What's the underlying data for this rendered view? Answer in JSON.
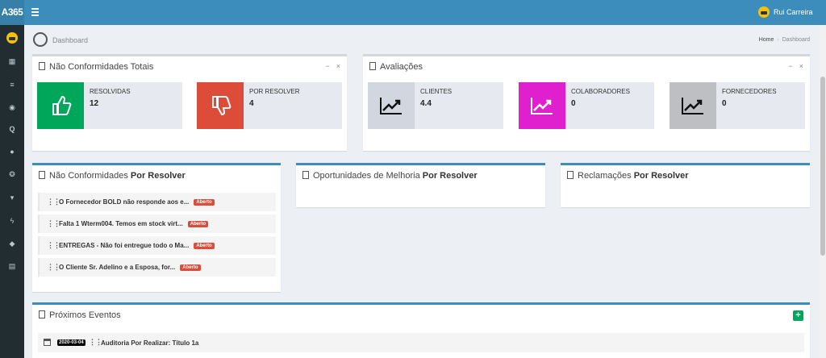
{
  "app": {
    "logo": "A365",
    "user": "Rui Carreira"
  },
  "page": {
    "title": "Dashboard"
  },
  "breadcrumb": {
    "home": "Home",
    "current": "Dashboard"
  },
  "sidebar": {
    "icons": [
      "avatar-icon",
      "calendar-icon",
      "list-icon",
      "target-icon",
      "search-icon",
      "info-icon",
      "globe-icon",
      "cart-icon",
      "flash-icon",
      "handshake-icon",
      "file-icon"
    ]
  },
  "nc_totais": {
    "title": "Não Conformidades Totais",
    "items": [
      {
        "label": "RESOLVIDAS",
        "value": "12",
        "color": "#00a65a",
        "icon": "thumbs-up-icon"
      },
      {
        "label": "POR RESOLVER",
        "value": "4",
        "color": "#dd4b39",
        "icon": "thumbs-down-icon"
      }
    ]
  },
  "avaliacoes": {
    "title": "Avaliações",
    "items": [
      {
        "label": "CLIENTES",
        "value": "4.4",
        "color": "#d2d6de",
        "icon": "line-chart-icon"
      },
      {
        "label": "COLABORADORES",
        "value": "0",
        "color": "#e01fcf",
        "icon": "line-chart-icon"
      },
      {
        "label": "FORNECEDORES",
        "value": "0",
        "color": "#bdbfc2",
        "icon": "line-chart-icon"
      }
    ]
  },
  "nc_resolver": {
    "title_pre": "Não Conformidades",
    "title_bold": "Por Resolver",
    "items": [
      {
        "text": "O Fornecedor BOLD não responde aos e...",
        "badge": "Aberto"
      },
      {
        "text": "Falta 1 Wterm004. Temos em stock virt...",
        "badge": "Aberto"
      },
      {
        "text": "ENTREGAS - Não foi entregue todo o Ma...",
        "badge": "Aberto"
      },
      {
        "text": "O Cliente Sr. Adelino e a Esposa, for...",
        "badge": "Aberto"
      }
    ]
  },
  "oportunidades": {
    "title_pre": "Oportunidades de Melhoria",
    "title_bold": "Por Resolver"
  },
  "reclamacoes": {
    "title_pre": "Reclamações",
    "title_bold": "Por Resolver"
  },
  "eventos": {
    "title": "Próximos Eventos",
    "items": [
      {
        "date": "2020-03-04",
        "text": "Auditoria Por Realizar: Título 1a"
      }
    ]
  },
  "box_tools": {
    "minimize": "−",
    "close": "×"
  },
  "colors": {
    "topbar": "#3c8dbc",
    "sidebar": "#222d32",
    "success": "#00a65a",
    "danger": "#dd4b39"
  }
}
